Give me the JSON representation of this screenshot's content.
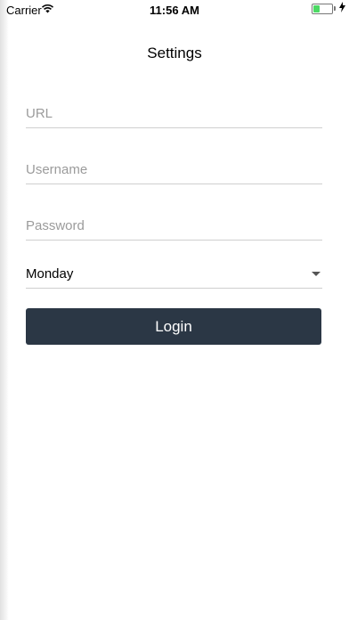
{
  "status_bar": {
    "carrier": "Carrier",
    "time": "11:56 AM",
    "battery_color": "#4cd964"
  },
  "header": {
    "title": "Settings"
  },
  "form": {
    "url": {
      "placeholder": "URL",
      "value": ""
    },
    "username": {
      "placeholder": "Username",
      "value": ""
    },
    "password": {
      "placeholder": "Password",
      "value": ""
    },
    "day_select": {
      "selected": "Monday"
    },
    "login_label": "Login",
    "button_color": "#2b3745"
  }
}
